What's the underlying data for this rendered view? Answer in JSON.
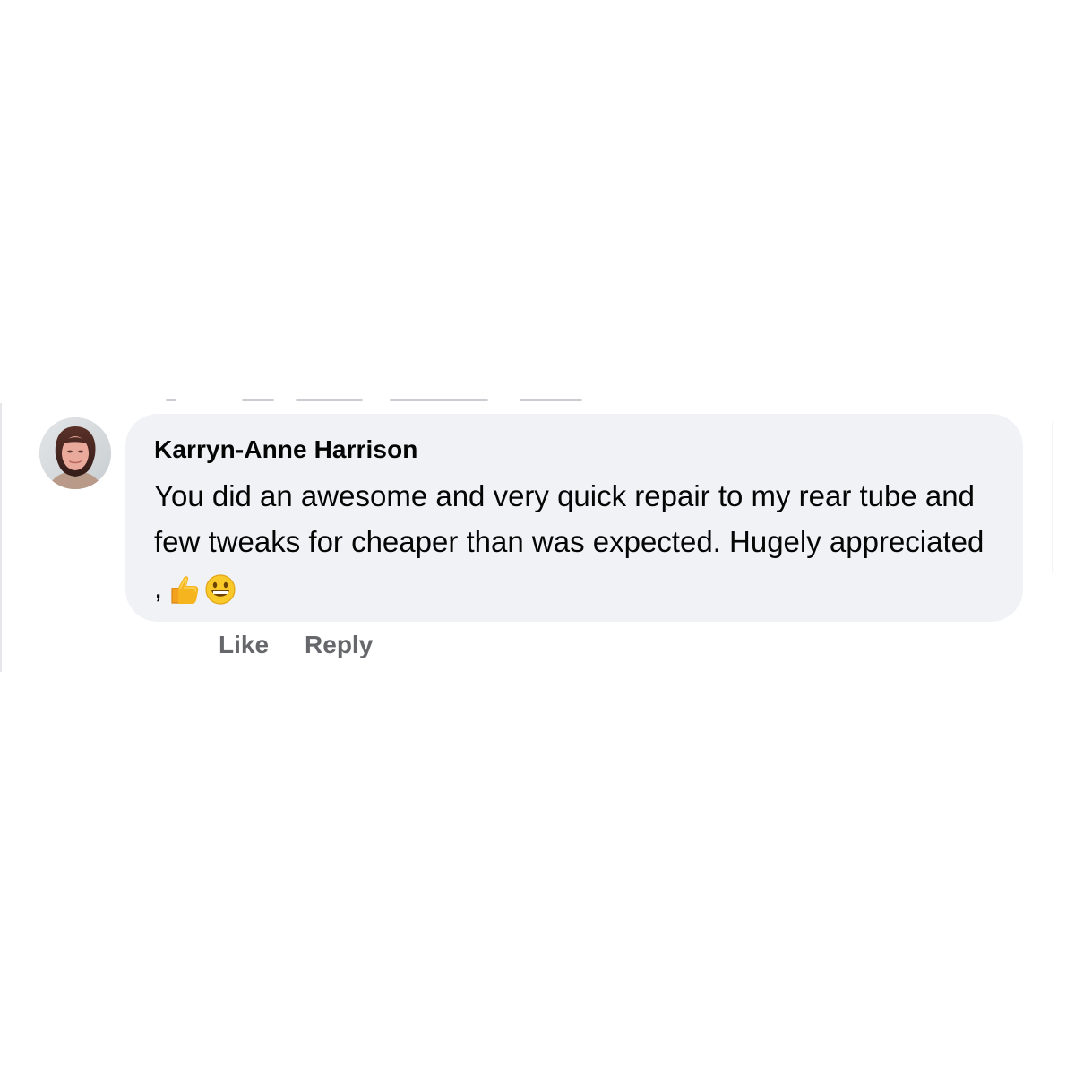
{
  "comment": {
    "author": "Karryn-Anne Harrison",
    "text": "You did an awesome and very quick repair to my rear tube and few tweaks for cheaper than was expected. Hugely appreciated ,",
    "emojis": [
      "thumbs-up-icon",
      "grinning-face-icon"
    ],
    "avatar": "profile-photo",
    "actions": {
      "like_label": "Like",
      "reply_label": "Reply"
    }
  },
  "colors": {
    "bubble": "#f0f2f5",
    "text": "#050505",
    "action_text": "#65676b"
  }
}
